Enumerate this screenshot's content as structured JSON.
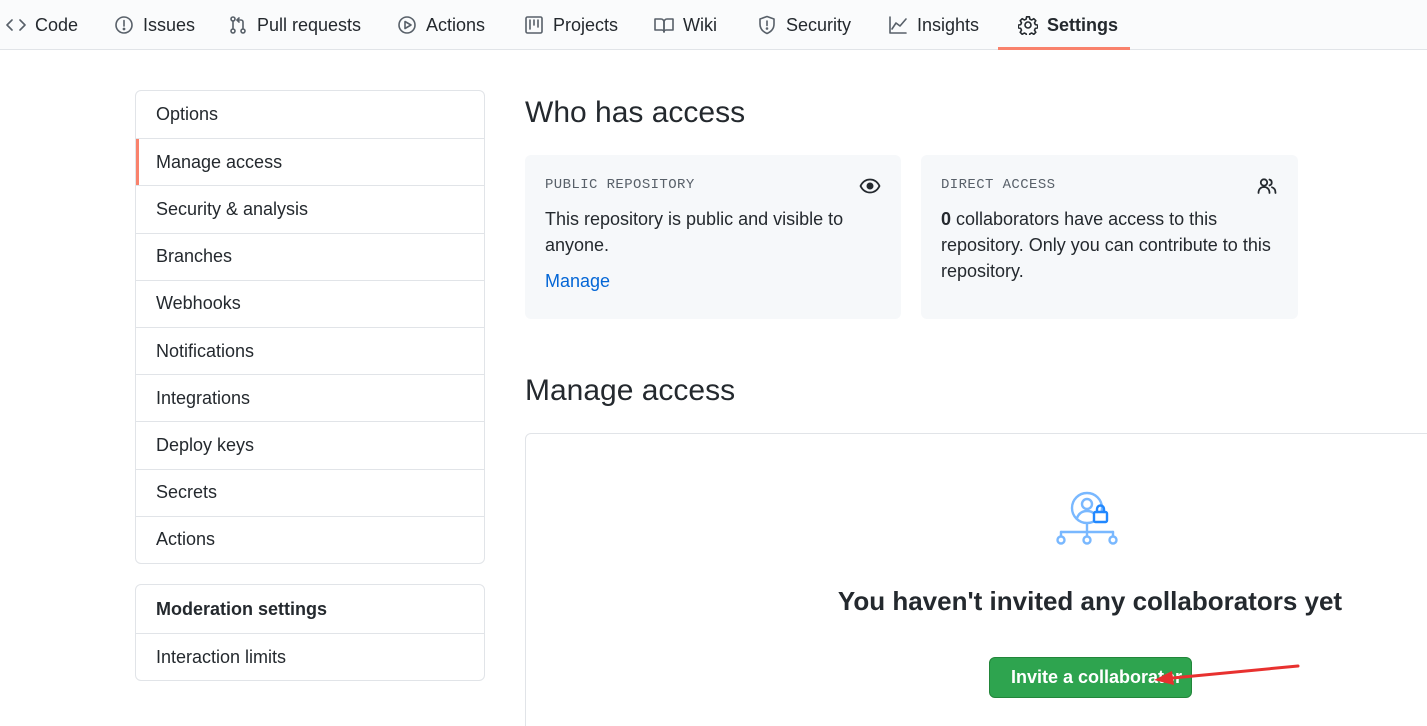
{
  "tabs": [
    {
      "label": "Code",
      "icon": "code-icon",
      "selected": false
    },
    {
      "label": "Issues",
      "icon": "issue-opened-icon",
      "selected": false
    },
    {
      "label": "Pull requests",
      "icon": "git-pull-request-icon",
      "selected": false
    },
    {
      "label": "Actions",
      "icon": "play-icon",
      "selected": false
    },
    {
      "label": "Projects",
      "icon": "project-icon",
      "selected": false
    },
    {
      "label": "Wiki",
      "icon": "book-icon",
      "selected": false
    },
    {
      "label": "Security",
      "icon": "shield-icon",
      "selected": false
    },
    {
      "label": "Insights",
      "icon": "graph-icon",
      "selected": false
    },
    {
      "label": "Settings",
      "icon": "gear-icon",
      "selected": true
    }
  ],
  "sidebar": {
    "items": [
      {
        "label": "Options",
        "selected": false
      },
      {
        "label": "Manage access",
        "selected": true
      },
      {
        "label": "Security & analysis",
        "selected": false
      },
      {
        "label": "Branches",
        "selected": false
      },
      {
        "label": "Webhooks",
        "selected": false
      },
      {
        "label": "Notifications",
        "selected": false
      },
      {
        "label": "Integrations",
        "selected": false
      },
      {
        "label": "Deploy keys",
        "selected": false
      },
      {
        "label": "Secrets",
        "selected": false
      },
      {
        "label": "Actions",
        "selected": false
      }
    ],
    "moderation": {
      "heading": "Moderation settings",
      "items": [
        {
          "label": "Interaction limits"
        }
      ]
    }
  },
  "who_has_access": {
    "title": "Who has access",
    "public_box": {
      "label": "PUBLIC REPOSITORY",
      "icon": "eye-icon",
      "text": "This repository is public and visible to anyone.",
      "link": "Manage"
    },
    "direct_box": {
      "label": "DIRECT ACCESS",
      "icon": "people-icon",
      "count": "0",
      "text": " collaborators have access to this repository. Only you can contribute to this repository."
    }
  },
  "manage_access": {
    "title": "Manage access",
    "empty_icon": "person-lock-tree-icon",
    "empty_title": "You haven't invited any collaborators yet",
    "invite_button": "Invite a collaborator"
  },
  "colors": {
    "accent_underline": "#f9826c",
    "link": "#0366d6",
    "button_green": "#2ea44f",
    "annotation_arrow": "#e8312f",
    "illustration_blue": "#79b8ff"
  }
}
